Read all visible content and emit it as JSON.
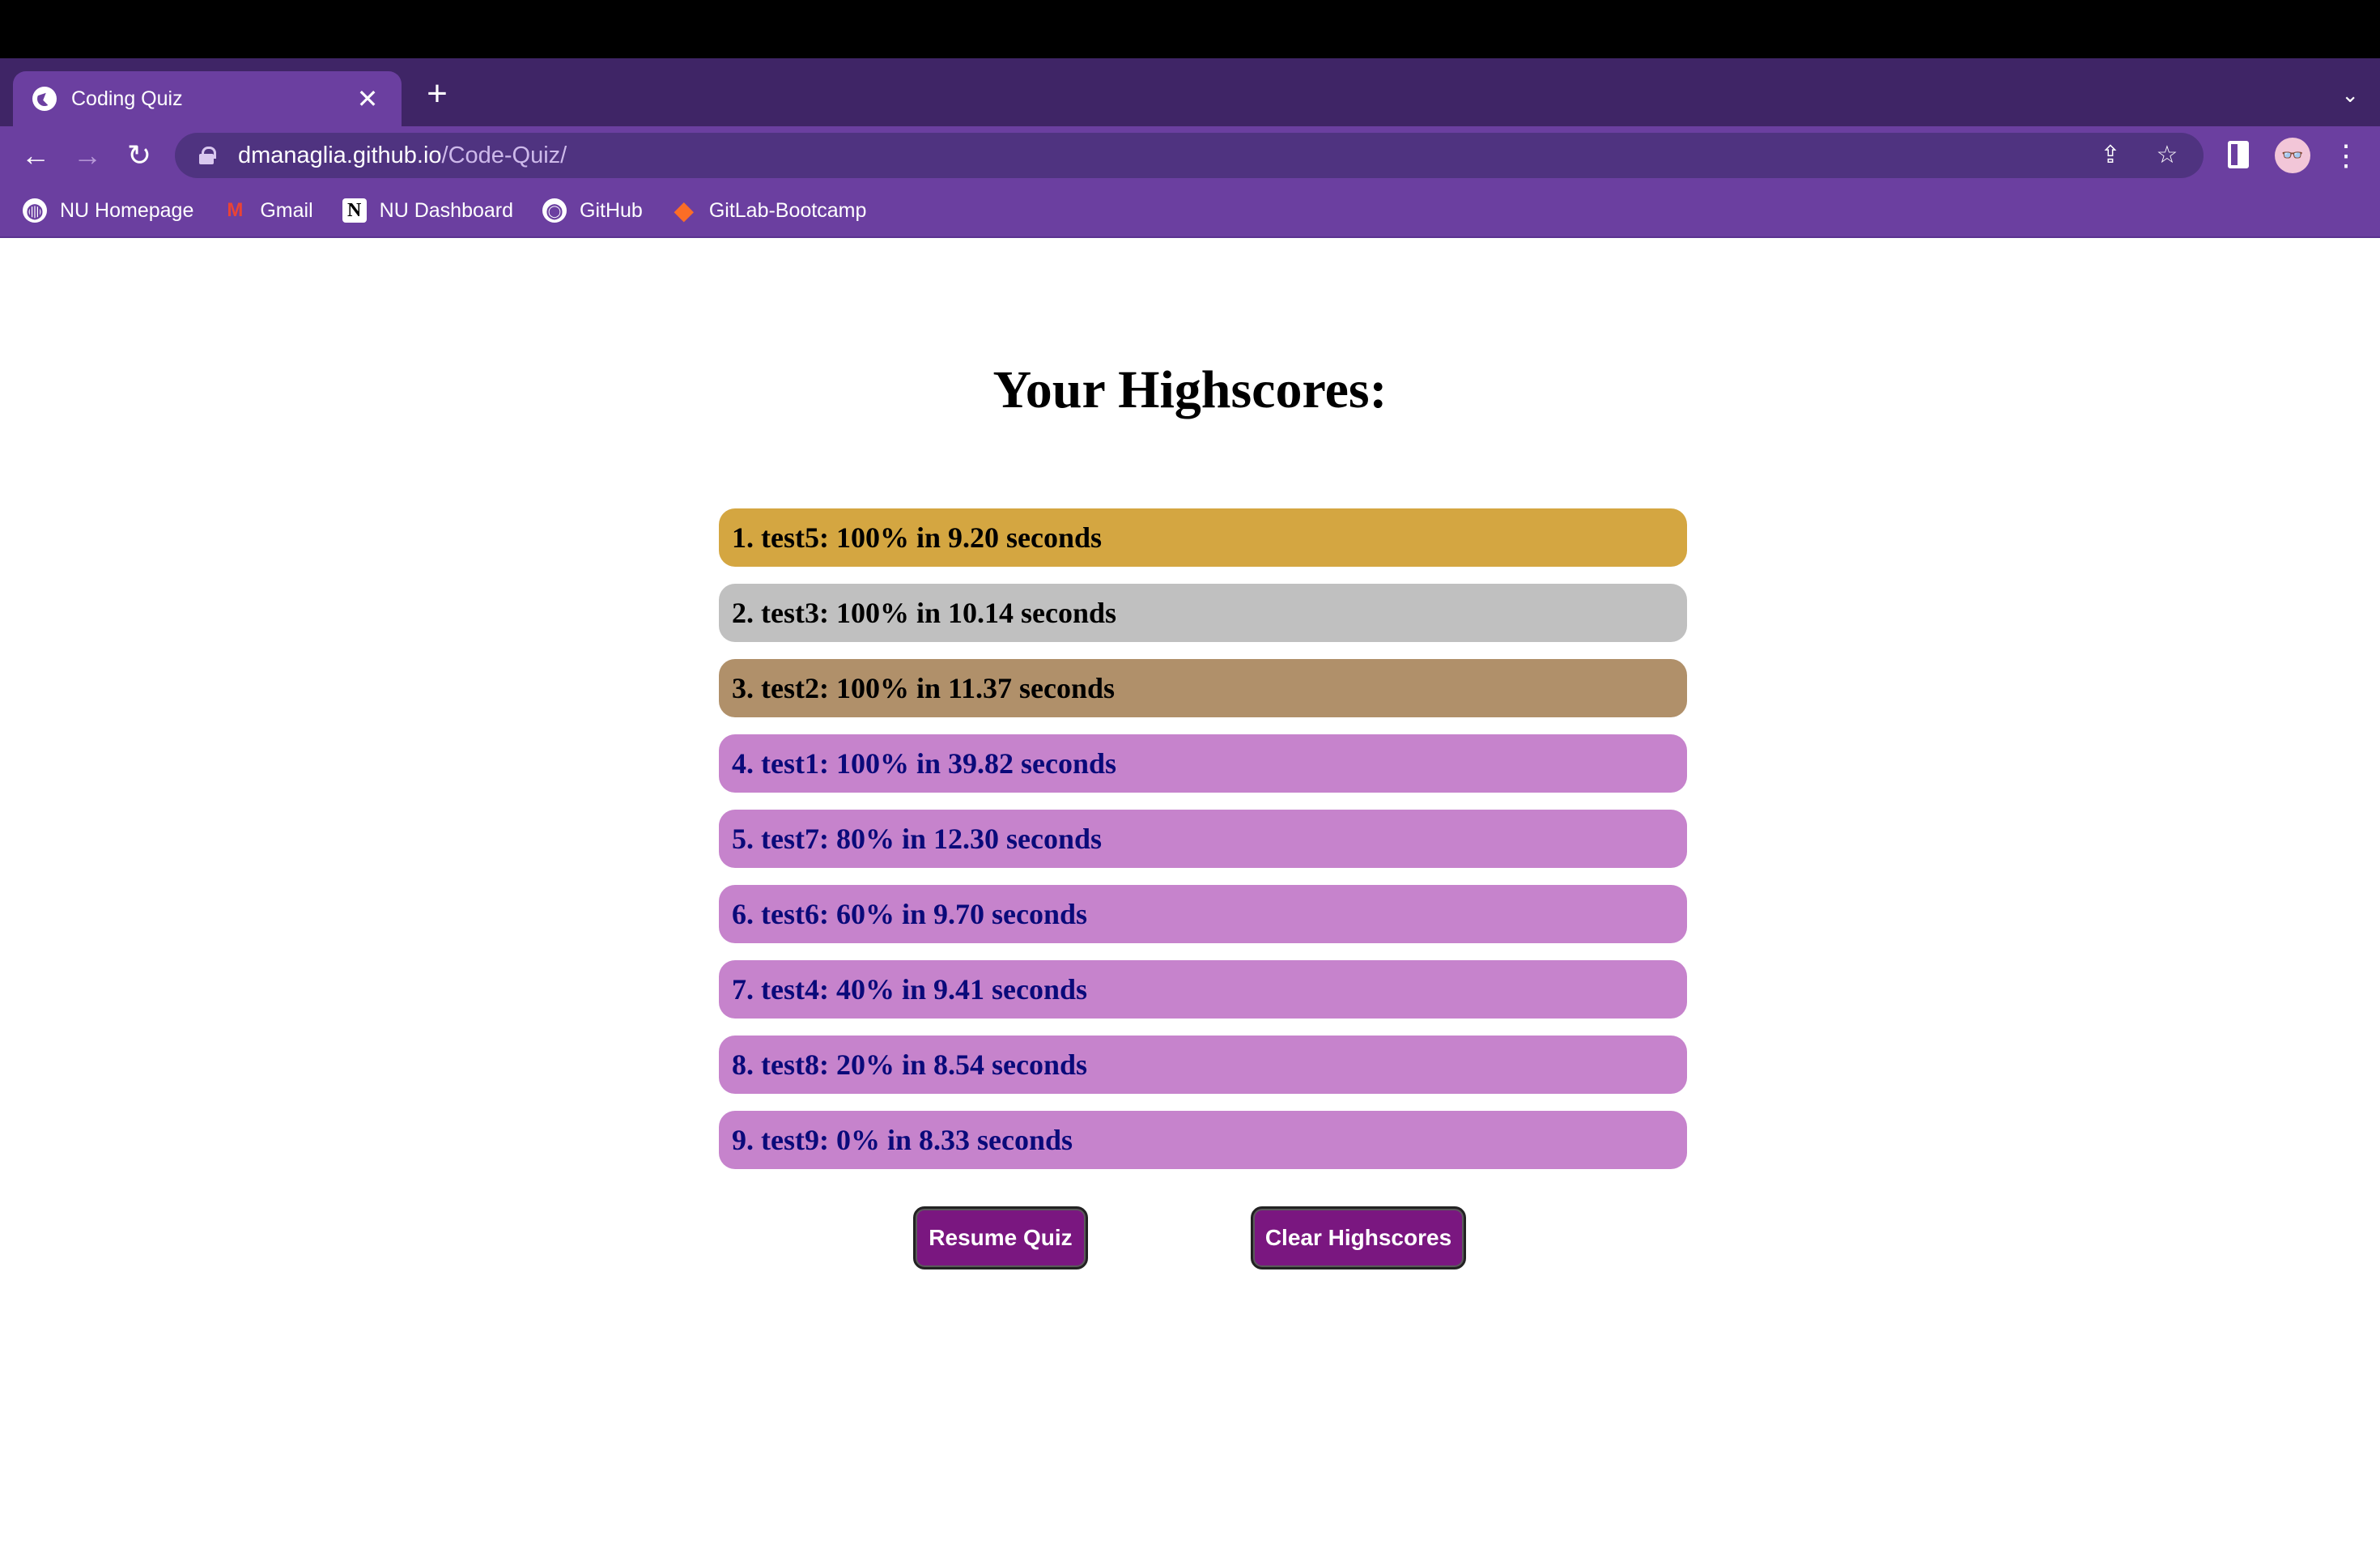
{
  "browser": {
    "tab_title": "Coding Quiz",
    "tab_close": "✕",
    "new_tab": "+",
    "tab_menu": "⌄",
    "url_host": "dmanaglia.github.io",
    "url_path": "/Code-Quiz/",
    "nav": {
      "back": "←",
      "forward": "→",
      "reload": "↻"
    },
    "omni_icons": {
      "share": "⇪",
      "star": "☆"
    },
    "avatar": "👓",
    "menu": "⋮",
    "bookmarks": [
      {
        "label": "NU Homepage",
        "icon": "globe-icon",
        "glyph": "◍"
      },
      {
        "label": "Gmail",
        "icon": "gmail-icon",
        "glyph": "M"
      },
      {
        "label": "NU Dashboard",
        "icon": "notion-icon",
        "glyph": "N"
      },
      {
        "label": "GitHub",
        "icon": "github-icon",
        "glyph": "◉"
      },
      {
        "label": "GitLab-Bootcamp",
        "icon": "gitlab-icon",
        "glyph": "◆"
      }
    ]
  },
  "page": {
    "heading": "Your Highscores:",
    "scores": [
      {
        "text": "1. test5: 100% in 9.20 seconds",
        "tier": "gold"
      },
      {
        "text": "2. test3: 100% in 10.14 seconds",
        "tier": "silver"
      },
      {
        "text": "3. test2: 100% in 11.37 seconds",
        "tier": "bronze"
      },
      {
        "text": "4. test1: 100% in 39.82 seconds",
        "tier": "other"
      },
      {
        "text": "5. test7: 80% in 12.30 seconds",
        "tier": "other"
      },
      {
        "text": "6. test6: 60% in 9.70 seconds",
        "tier": "other"
      },
      {
        "text": "7. test4: 40% in 9.41 seconds",
        "tier": "other"
      },
      {
        "text": "8. test8: 20% in 8.54 seconds",
        "tier": "other"
      },
      {
        "text": "9. test9: 0% in 8.33 seconds",
        "tier": "other"
      }
    ],
    "resume_button": "Resume Quiz",
    "clear_button": "Clear Highscores"
  },
  "colors": {
    "gold": "#d4a641",
    "silver": "#c0c0c0",
    "bronze": "#b0906a",
    "other": "#c683cc",
    "button": "#7a1780",
    "browser_purple": "#6b3fa0"
  }
}
